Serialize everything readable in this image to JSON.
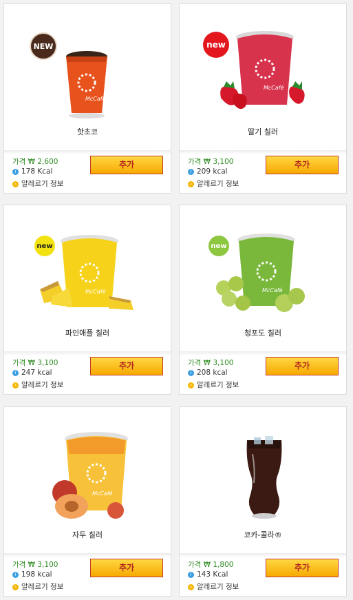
{
  "products": [
    {
      "name": "핫초코",
      "price_label": "가격 ₩ 2,600",
      "kcal_label": "178 Kcal",
      "allergy_label": "알레르기 정보",
      "add_label": "추가",
      "badge": "NEW"
    },
    {
      "name": "딸기 칠러",
      "price_label": "가격 ₩ 3,100",
      "kcal_label": "209 kcal",
      "allergy_label": "알레르기 정보",
      "add_label": "추가",
      "badge": "new"
    },
    {
      "name": "파인애플 칠러",
      "price_label": "가격 ₩ 3,100",
      "kcal_label": "247 kcal",
      "allergy_label": "알레르기 정보",
      "add_label": "추가",
      "badge": "new"
    },
    {
      "name": "청포도 칠러",
      "price_label": "가격 ₩ 3,100",
      "kcal_label": "208 kcal",
      "allergy_label": "알레르기 정보",
      "add_label": "추가",
      "badge": "new"
    },
    {
      "name": "자두 칠러",
      "price_label": "가격 ₩ 3,100",
      "kcal_label": "198 kcal",
      "allergy_label": "알레르기 정보",
      "add_label": "추가",
      "badge": ""
    },
    {
      "name": "코카-콜라®",
      "price_label": "가격 ₩ 1,800",
      "kcal_label": "143 Kcal",
      "allergy_label": "알레르기 정보",
      "add_label": "추가",
      "badge": ""
    }
  ],
  "colors": {
    "price_text": "#2e8b22",
    "button_top": "#ffd743",
    "button_bottom": "#f7a900",
    "button_text": "#b3261e"
  }
}
